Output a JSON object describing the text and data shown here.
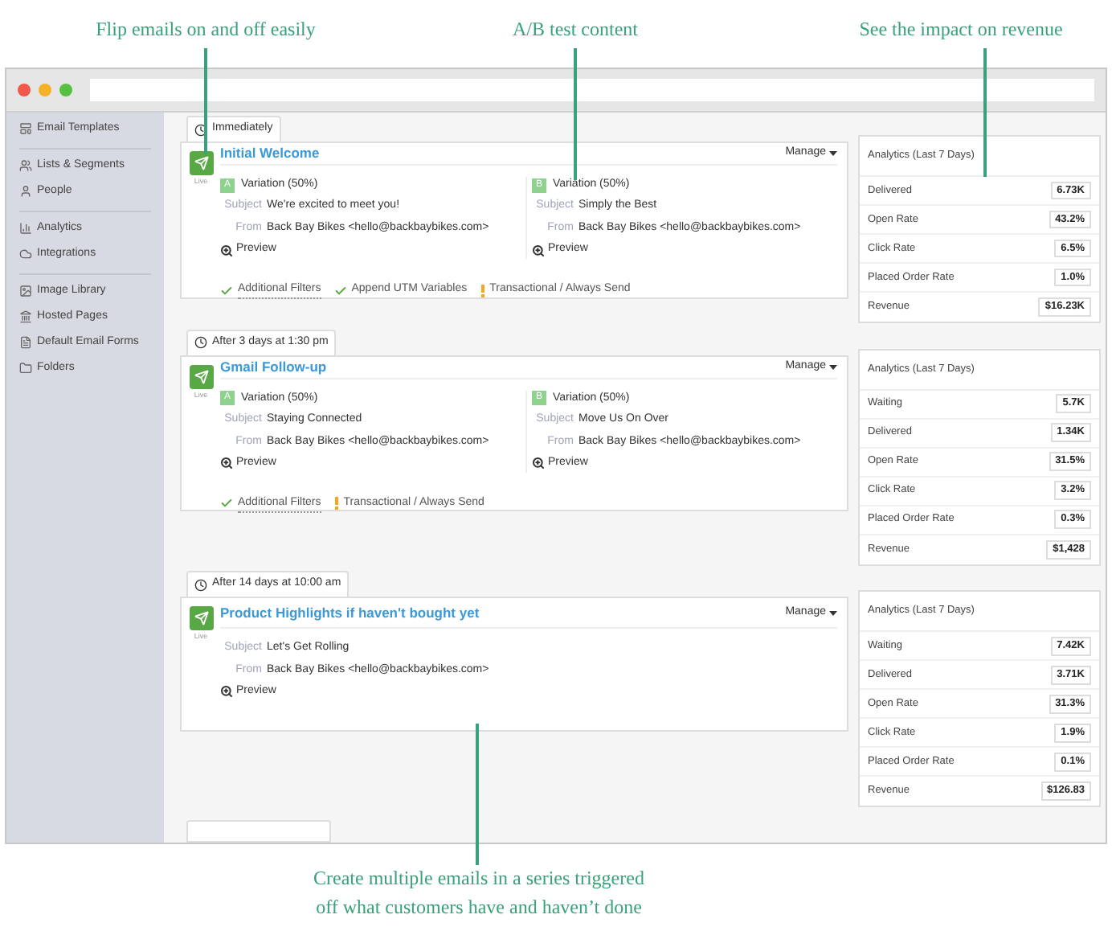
{
  "callouts": [
    {
      "text": "Flip emails on and off easily"
    },
    {
      "text": "A/B test content"
    },
    {
      "text": "See the impact on revenue"
    }
  ],
  "caption": [
    "Create multiple emails in a series triggered",
    "off what customers have and haven’t done"
  ],
  "sidebar": {
    "groups": [
      [
        {
          "label": "Email Templates"
        }
      ],
      [
        {
          "label": "Lists & Segments"
        },
        {
          "label": "People"
        }
      ],
      [
        {
          "label": "Analytics"
        },
        {
          "label": "Integrations"
        }
      ],
      [
        {
          "label": "Image Library"
        },
        {
          "label": "Hosted Pages"
        },
        {
          "label": "Default Email Forms"
        },
        {
          "label": "Folders"
        }
      ]
    ]
  },
  "emails": [
    {
      "delay": "Immediately",
      "title": "Initial Welcome",
      "status": "Live",
      "manage": "Manage",
      "variations": [
        {
          "letter": "A",
          "label": "Variation (50%)",
          "subject_label": "Subject",
          "subject": "We're excited to meet you!",
          "from_label": "From",
          "from": "Back Bay Bikes <hello@backbaybikes.com>",
          "preview": "Preview"
        },
        {
          "letter": "B",
          "label": "Variation (50%)",
          "subject_label": "Subject",
          "subject": "Simply the Best",
          "from_label": "From",
          "from": "Back Bay Bikes <hello@backbaybikes.com>",
          "preview": "Preview"
        }
      ],
      "options": [
        {
          "kind": "filter",
          "label": "Additional Filters"
        },
        {
          "kind": "check",
          "label": "Append UTM Variables"
        },
        {
          "kind": "warning",
          "label": "Transactional / Always Send"
        }
      ],
      "analytics": {
        "title": "Analytics (Last 7 Days)",
        "rows": [
          {
            "label": "Delivered",
            "value": "6.73K"
          },
          {
            "label": "Open Rate",
            "value": "43.2%"
          },
          {
            "label": "Click Rate",
            "value": "6.5%"
          },
          {
            "label": "Placed Order Rate",
            "value": "1.0%"
          },
          {
            "label": "Revenue",
            "value": "$16.23K"
          }
        ]
      }
    },
    {
      "delay": "After 3 days at 1:30 pm",
      "title": "Gmail Follow-up",
      "status": "Live",
      "manage": "Manage",
      "variations": [
        {
          "letter": "A",
          "label": "Variation (50%)",
          "subject_label": "Subject",
          "subject": "Staying Connected",
          "from_label": "From",
          "from": "Back Bay Bikes <hello@backbaybikes.com>",
          "preview": "Preview"
        },
        {
          "letter": "B",
          "label": "Variation (50%)",
          "subject_label": "Subject",
          "subject": "Move Us On Over",
          "from_label": "From",
          "from": "Back Bay Bikes <hello@backbaybikes.com>",
          "preview": "Preview"
        }
      ],
      "options": [
        {
          "kind": "filter",
          "label": "Additional Filters"
        },
        {
          "kind": "warning",
          "label": "Transactional / Always Send"
        }
      ],
      "analytics": {
        "title": "Analytics (Last 7 Days)",
        "rows": [
          {
            "label": "Waiting",
            "value": "5.7K"
          },
          {
            "label": "Delivered",
            "value": "1.34K"
          },
          {
            "label": "Open Rate",
            "value": "31.5%"
          },
          {
            "label": "Click Rate",
            "value": "3.2%"
          },
          {
            "label": "Placed Order Rate",
            "value": "0.3%"
          },
          {
            "label": "Revenue",
            "value": "$1,428"
          }
        ]
      }
    },
    {
      "delay": "After 14 days at 10:00 am",
      "title": "Product Highlights if haven't bought yet",
      "status": "Live",
      "manage": "Manage",
      "variations": [
        {
          "subject_label": "Subject",
          "subject": "Let's Get Rolling",
          "from_label": "From",
          "from": "Back Bay Bikes <hello@backbaybikes.com>",
          "preview": "Preview"
        }
      ],
      "analytics": {
        "title": "Analytics (Last 7 Days)",
        "rows": [
          {
            "label": "Waiting",
            "value": "7.42K"
          },
          {
            "label": "Delivered",
            "value": "3.71K"
          },
          {
            "label": "Open Rate",
            "value": "31.3%"
          },
          {
            "label": "Click Rate",
            "value": "1.9%"
          },
          {
            "label": "Placed Order Rate",
            "value": "0.1%"
          },
          {
            "label": "Revenue",
            "value": "$126.83"
          }
        ]
      }
    }
  ]
}
